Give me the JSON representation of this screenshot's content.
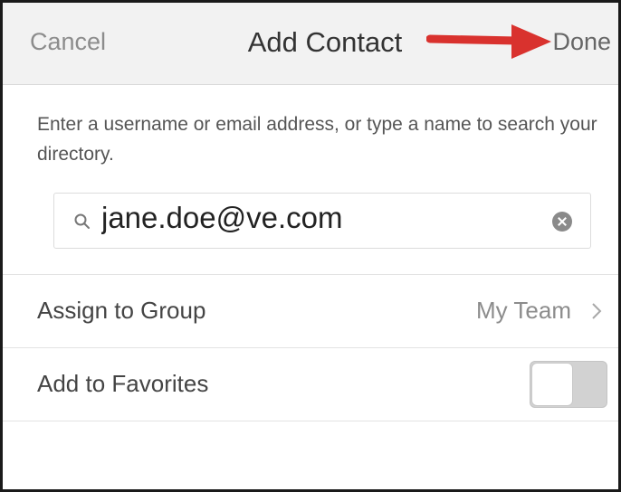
{
  "navbar": {
    "cancel_label": "Cancel",
    "title": "Add Contact",
    "done_label": "Done"
  },
  "instructions": "Enter a username or email address, or type a name to search your directory.",
  "search": {
    "value": "jane.doe@ve.com",
    "icon": "search-icon",
    "clear_icon": "clear-icon"
  },
  "rows": {
    "group": {
      "label": "Assign to Group",
      "value": "My Team",
      "icon": "chevron-right-icon"
    },
    "favorites": {
      "label": "Add to Favorites",
      "toggle_on": false
    }
  },
  "colors": {
    "annotation_arrow": "#d9322e",
    "navbar_background": "#f2f2f2",
    "toggle_off": "#d2d2d2"
  }
}
